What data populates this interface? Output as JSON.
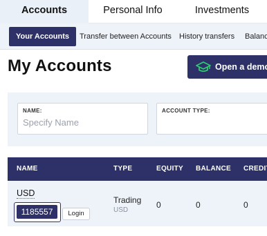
{
  "top_tabs": [
    "Accounts",
    "Personal Info",
    "Investments"
  ],
  "sub_tabs": [
    "Your Accounts",
    "Transfer between Accounts",
    "History transfers",
    "Balanc"
  ],
  "page_title": "My Accounts",
  "demo_button": "Open a demo",
  "filters": {
    "name_label": "NAME:",
    "name_placeholder": "Specify Name",
    "type_label": "ACCOUNT TYPE:"
  },
  "table": {
    "headers": [
      "NAME",
      "TYPE",
      "EQUITY",
      "BALANCE",
      "CREDIT"
    ],
    "rows": [
      {
        "currency": "USD",
        "account_id": "1185557",
        "login": "Login",
        "type": "Trading",
        "type_currency": "USD",
        "equity": "0",
        "balance": "0",
        "credit": "0"
      }
    ]
  },
  "colors": {
    "primary": "#2d3168",
    "panel": "#eef3fa",
    "accent_icon": "#2ecc71"
  },
  "icons": {
    "demo": "graduation-cap-icon"
  }
}
